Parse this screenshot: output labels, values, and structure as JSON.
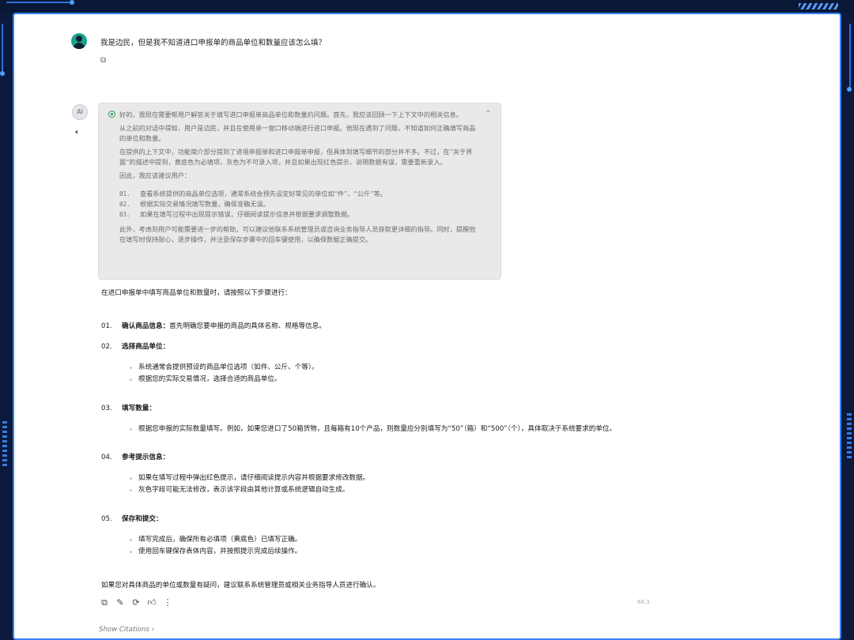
{
  "user_message": "我是边民，但是我不知道进口申报单的商品单位和数量应该怎么填？",
  "thinking": {
    "paragraphs": [
      "好的，我现在需要帮用户解答关于填写进口申报单商品单位和数量的问题。首先，我应该回顾一下上下文中的相关信息。",
      "从之前的对话中得知，用户是边民，并且在使用单一窗口移动端进行进口申报。他现在遇到了问题，不知道如何正确填写商品的单位和数量。",
      "在提供的上下文中，功能简介部分提到了进境申报单和进口申报单申报，但具体到填写细节的部分并不多。不过，在“关于界面”的描述中提到，黄底色为必填项，灰色为不可录入项，并且如果出现红色提示，说明数据有误，需要重新录入。",
      "因此，我应该建议用户："
    ],
    "list": [
      {
        "num": "01.",
        "text": "查看系统提供的商品单位选项，通常系统会预先设定好常见的单位如“件”、“公斤”等。"
      },
      {
        "num": "02.",
        "text": "根据实际交易情况填写数量，确保准确无误。"
      },
      {
        "num": "03.",
        "text": "如果在填写过程中出现提示错误，仔细阅读提示信息并根据要求调整数据。"
      }
    ],
    "closing": "此外，考虑到用户可能需要进一步的帮助，可以建议他联系系统管理员或咨询业务指导人员获取更详细的指导。同时，提醒他在填写时保持耐心，逐步操作，并注意保存步骤中的回车键使用，以确保数据正确提交。"
  },
  "answer": {
    "intro": "在进口申报单中填写商品单位和数量时，请按照以下步骤进行：",
    "steps": [
      {
        "num": "01.",
        "title": "确认商品信息：",
        "text": "首先明确您要申报的商品的具体名称、规格等信息。",
        "bullets": []
      },
      {
        "num": "02.",
        "title": "选择商品单位：",
        "text": "",
        "bullets": [
          "系统通常会提供预设的商品单位选项（如件、公斤、个等）。",
          "根据您的实际交易情况，选择合适的商品单位。"
        ]
      },
      {
        "num": "03.",
        "title": "填写数量：",
        "text": "",
        "bullets": [
          "根据您申报的实际数量填写。例如，如果您进口了50箱货物，且每箱有10个产品，则数量应分别填写为“50”（箱）和“500”（个），具体取决于系统要求的单位。"
        ]
      },
      {
        "num": "04.",
        "title": "参考提示信息：",
        "text": "",
        "bullets": [
          "如果在填写过程中弹出红色提示，请仔细阅读提示内容并根据要求修改数据。",
          "灰色字段可能无法修改，表示该字段由其他计算或系统逻辑自动生成。"
        ]
      },
      {
        "num": "05.",
        "title": "保存和提交：",
        "text": "",
        "bullets": [
          "填写完成后，确保所有必填项（黄底色）已填写正确。",
          "使用回车键保存表体内容，并按照提示完成后续操作。"
        ]
      }
    ],
    "closing": "如果您对具体商品的单位或数量有疑问，建议联系系统管理员或相关业务指导人员进行确认。"
  },
  "bot_avatar_text": "AI",
  "version": "68.3",
  "show_citations": "Show Citations",
  "icons": [
    "copy-icon",
    "edit-icon",
    "regenerate-icon",
    "thumbs-up-icon",
    "more-icon",
    "chevron-right-icon",
    "speaker-icon",
    "chevron-up-icon"
  ],
  "colors": {
    "accent": "#3b82f6",
    "think_bg": "#e9e9e9",
    "frame": "#0b1a3c"
  }
}
